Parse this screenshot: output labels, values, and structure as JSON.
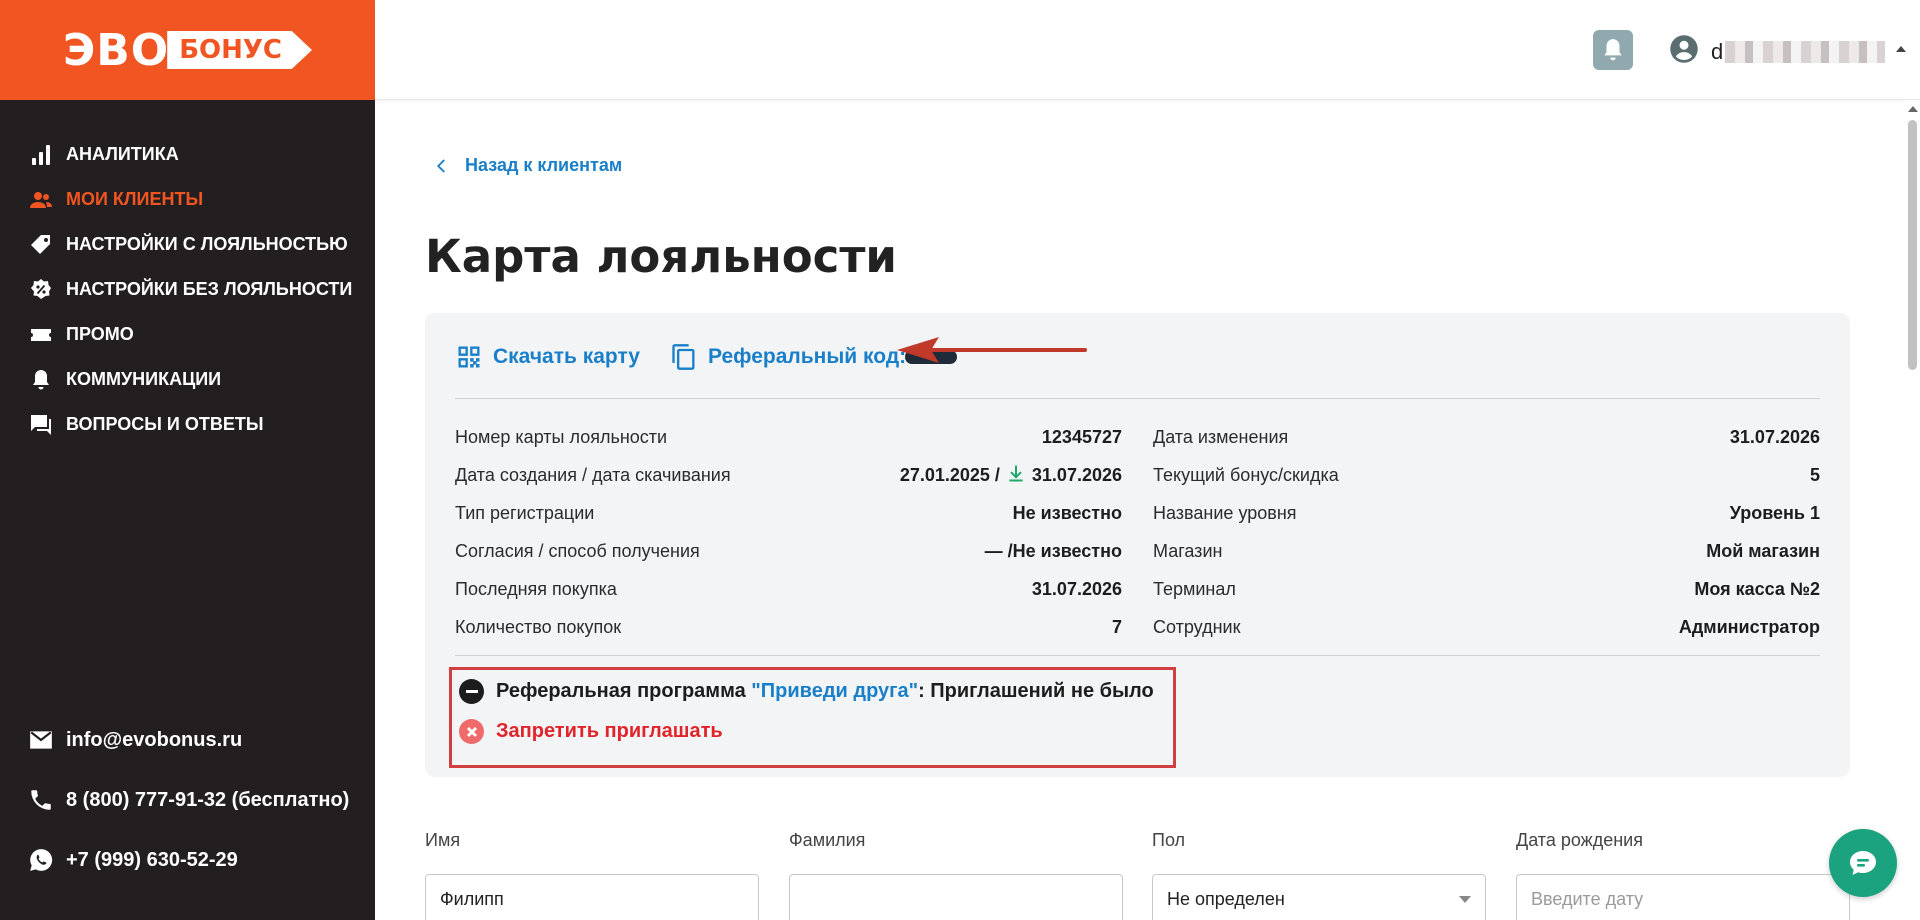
{
  "brand": {
    "logo_left": "ЭВО",
    "logo_right": "БОНУС",
    "accent": "#f05522",
    "link": "#1a7fc9",
    "sidebar_bg": "#231f20"
  },
  "sidebar": {
    "items": [
      {
        "label": "АНАЛИТИКА",
        "icon": "bar-chart-icon"
      },
      {
        "label": "МОИ КЛИЕНТЫ",
        "icon": "people-icon"
      },
      {
        "label": "НАСТРОЙКИ С ЛОЯЛЬНОСТЬЮ",
        "icon": "tag-icon"
      },
      {
        "label": "НАСТРОЙКИ БЕЗ ЛОЯЛЬНОСТИ",
        "icon": "percent-badge-icon"
      },
      {
        "label": "ПРОМО",
        "icon": "ticket-icon"
      },
      {
        "label": "КОММУНИКАЦИИ",
        "icon": "bell-icon"
      },
      {
        "label": "ВОПРОСЫ И ОТВЕТЫ",
        "icon": "chat-icon"
      }
    ],
    "contacts": {
      "email": "info@evobonus.ru",
      "phone_free": "8 (800) 777-91-32 (бесплатно)",
      "whatsapp": "+7 (999) 630-52-29"
    }
  },
  "header": {
    "user_initial": "d"
  },
  "main": {
    "back_label": "Назад к клиентам",
    "title": "Карта лояльности",
    "download_card": "Скачать карту",
    "referral_code": "Реферальный код: 85W",
    "left_rows": [
      {
        "label": "Номер карты лояльности",
        "value": "12345727"
      },
      {
        "label": "Дата создания / дата скачивания",
        "value_created": "27.01.2025 /",
        "value_downloaded": "31.07.2026"
      },
      {
        "label": "Тип регистрации",
        "value": "Не известно"
      },
      {
        "label": "Согласия / способ получения",
        "value": "— /Не известно"
      },
      {
        "label": "Последняя покупка",
        "value": "31.07.2026"
      },
      {
        "label": "Количество покупок",
        "value": "7"
      }
    ],
    "right_rows": [
      {
        "label": "Дата изменения",
        "value": "31.07.2026"
      },
      {
        "label": "Текущий бонус/скидка",
        "value": "5"
      },
      {
        "label": "Название уровня",
        "value": "Уровень 1"
      },
      {
        "label": "Магазин",
        "value": "Мой магазин"
      },
      {
        "label": "Терминал",
        "value": "Моя касса №2"
      },
      {
        "label": "Сотрудник",
        "value": "Администратор"
      }
    ],
    "referral": {
      "prefix": "Реферальная программа ",
      "program_name": "\"Приведи друга\"",
      "suffix": ": Приглашений не было",
      "forbid_label": "Запретить приглашать"
    }
  },
  "form": {
    "first_name": {
      "label": "Имя",
      "value": "Филипп"
    },
    "last_name": {
      "label": "Фамилия",
      "value": ""
    },
    "gender": {
      "label": "Пол",
      "value": "Не определен"
    },
    "birthdate": {
      "label": "Дата рождения",
      "placeholder": "Введите дату"
    }
  }
}
